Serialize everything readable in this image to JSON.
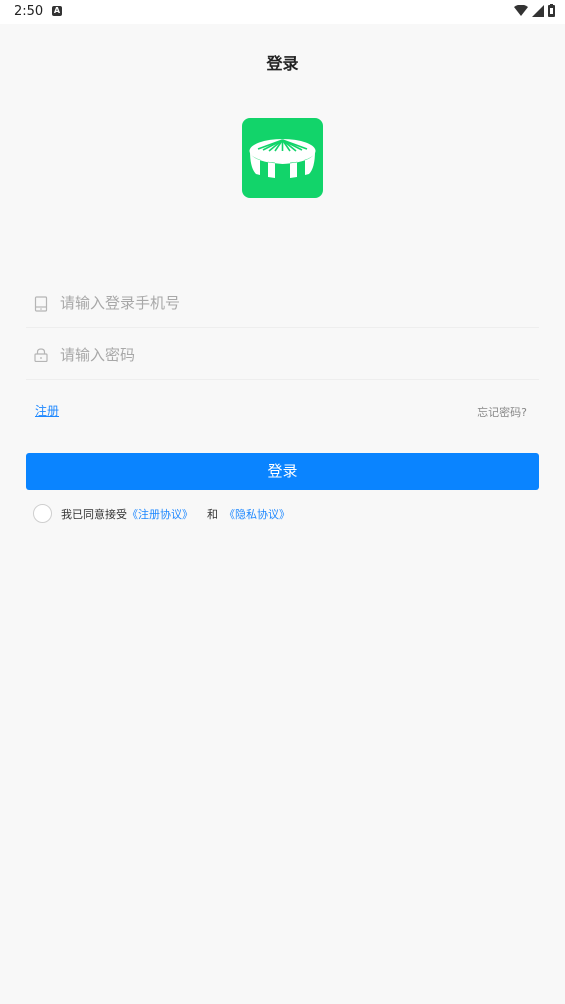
{
  "status": {
    "time": "2:50",
    "notification_icon": "a-badge-icon",
    "wifi_icon": "wifi-icon",
    "signal_icon": "signal-icon",
    "battery_icon": "battery-icon"
  },
  "header": {
    "title": "登录"
  },
  "logo": {
    "icon": "canopy-tent-icon",
    "color": "#12d46a"
  },
  "form": {
    "phone_placeholder": "请输入登录手机号",
    "password_placeholder": "请输入密码"
  },
  "links": {
    "register": "注册",
    "forgot": "忘记密码?"
  },
  "login_button": {
    "label": "登录",
    "color": "#0a84ff"
  },
  "agreement": {
    "prefix": "我已同意接受",
    "register_agreement": "《注册协议》",
    "and": "和",
    "privacy_agreement": "《隐私协议》"
  }
}
